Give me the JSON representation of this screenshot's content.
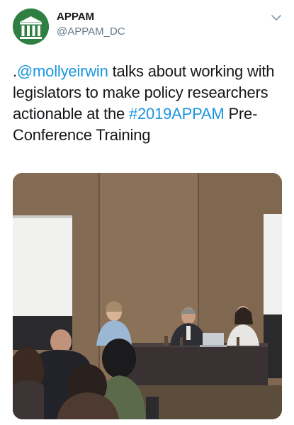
{
  "account": {
    "name": "APPAM",
    "handle": "@APPAM_DC",
    "avatar_icon": "appam-columns-logo",
    "brand_color": "#2f7f43"
  },
  "menu": {
    "icon": "chevron-down-icon"
  },
  "tweet": {
    "prefix": ".",
    "mention": "@mollyeirwin",
    "text_1": " talks about working with legislators to make policy researchers actionable at the ",
    "hashtag": "#2019APPAM",
    "text_2": " Pre-Conference Training",
    "link_color": "#1b95e0"
  },
  "media": {
    "type": "photo"
  }
}
